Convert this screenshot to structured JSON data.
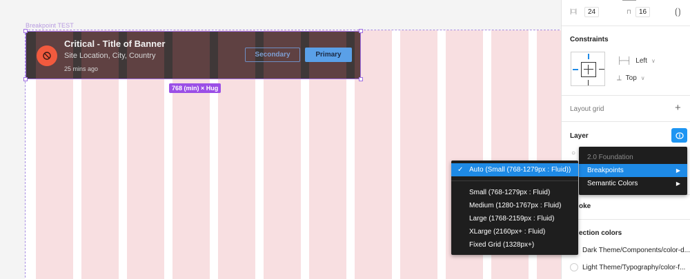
{
  "canvas": {
    "frame_label": "Breakpoint TEST",
    "size_badge": "768 (min) × Hug",
    "column_color": "#f8dfe1",
    "selection_color": "#9d6ce0"
  },
  "banner": {
    "title": "Critical - Title of Banner",
    "location": "Site Location, City, Country",
    "timestamp": "25 mins ago",
    "icon": "block-icon",
    "icon_color": "#f15a3e",
    "secondary_label": "Secondary",
    "primary_label": "Primary",
    "primary_color": "#5aa0e8"
  },
  "panel": {
    "spacing": {
      "padding_value": "24",
      "gap_value": "16"
    },
    "constraints": {
      "title": "Constraints",
      "horizontal": "Left",
      "vertical": "Top"
    },
    "layout_grid": {
      "title": "Layout grid"
    },
    "layer": {
      "title": "Layer"
    },
    "stroke": {
      "title": "oke"
    },
    "selection_colors": {
      "title": "ection colors",
      "items": [
        "Dark Theme/Components/color-d...",
        "Light Theme/Typography/color-f..."
      ]
    }
  },
  "menu_main": {
    "header": "2.0 Foundation",
    "items": [
      {
        "label": "Breakpoints",
        "has_submenu": true,
        "active": true
      },
      {
        "label": "Semantic Colors",
        "has_submenu": true,
        "active": false
      }
    ],
    "accent": "#1e8ae6"
  },
  "menu_sub": {
    "selected": "Auto (Small (768-1279px : Fluid))",
    "items": [
      "Small (768-1279px : Fluid)",
      "Medium (1280-1767px : Fluid)",
      "Large (1768-2159px : Fluid)",
      "XLarge (2160px+ : Fluid)",
      "Fixed Grid (1328px+)"
    ]
  }
}
